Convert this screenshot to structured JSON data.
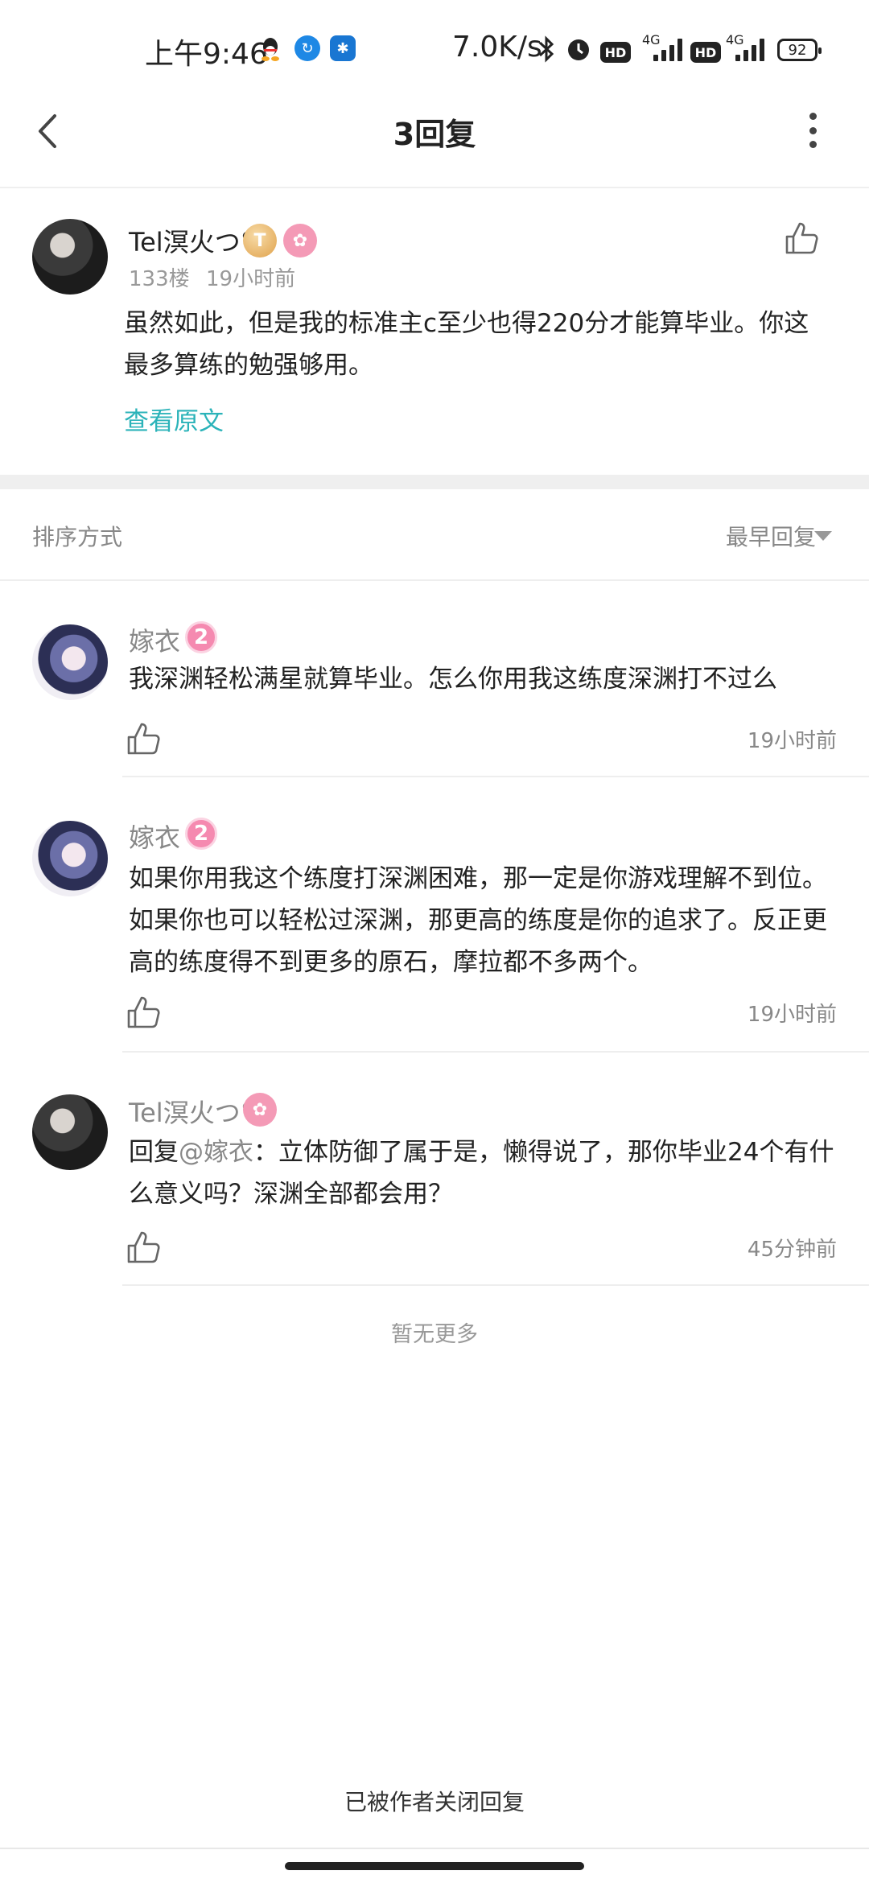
{
  "status_bar": {
    "time": "上午9:46",
    "net_speed": "7.0K/s",
    "battery": "92",
    "signal1_label": "4G",
    "signal2_label": "4G",
    "hd_label": "HD"
  },
  "header": {
    "title": "3回复"
  },
  "main_post": {
    "author": "Tel溟火つ°",
    "badge_level": "T5",
    "floor": "133楼",
    "time": "19小时前",
    "content": "虽然如此，但是我的标准主c至少也得220分才能算毕业。你这最多算练的勉强够用。",
    "view_original": "查看原文"
  },
  "sort": {
    "label": "排序方式",
    "value": "最早回复"
  },
  "replies": [
    {
      "author": "嫁衣",
      "level": "2",
      "content": "我深渊轻松满星就算毕业。怎么你用我这练度深渊打不过么",
      "time": "19小时前"
    },
    {
      "author": "嫁衣",
      "level": "2",
      "content": "如果你用我这个练度打深渊困难，那一定是你游戏理解不到位。如果你也可以轻松过深渊，那更高的练度是你的追求了。反正更高的练度得不到更多的原石，摩拉都不多两个。",
      "time": "19小时前"
    },
    {
      "author": "Tel溟火つ°",
      "reply_prefix": "回复",
      "reply_target": "@嫁衣",
      "content": "：立体防御了属于是，懒得说了，那你毕业24个有什么意义吗？深渊全部都会用？",
      "time": "45分钟前"
    }
  ],
  "footer": {
    "no_more": "暂无更多",
    "closed": "已被作者关闭回复"
  },
  "colors": {
    "accent_link": "#2bb3b9",
    "level_badge": "#f58ab0",
    "divider": "#efefef"
  }
}
